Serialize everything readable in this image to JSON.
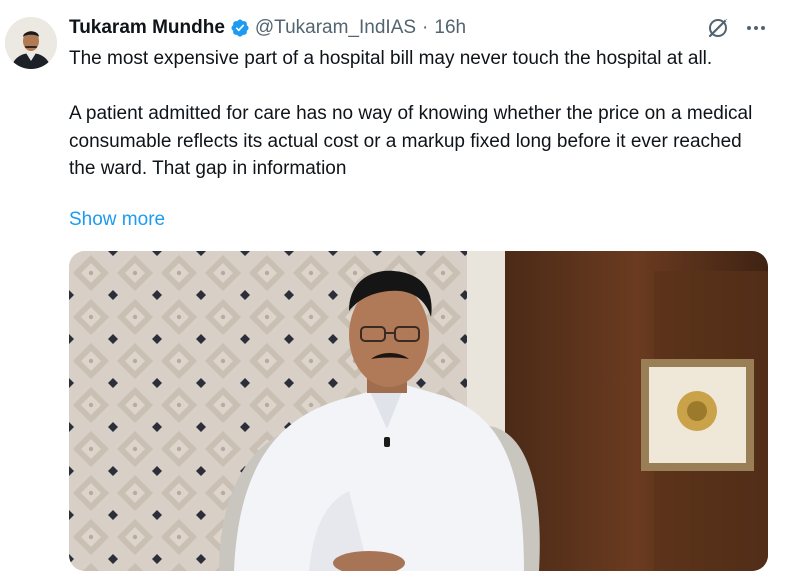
{
  "tweet": {
    "author_name": "Tukaram Mundhe",
    "handle": "@Tukaram_IndIAS",
    "separator": "·",
    "time": "16h",
    "paragraph_1": "The most expensive part of a hospital bill may never touch the hospital at all.",
    "paragraph_2": "A patient admitted for care has no way of knowing whether the price on a medical consumable reflects its actual cost or a markup fixed long before it ever reached the ward. That gap in information",
    "show_more_label": "Show more"
  },
  "icons": {
    "verified": "verified-badge-icon",
    "grok": "grok-icon",
    "more": "more-options-icon"
  },
  "colors": {
    "text": "#0f1419",
    "secondary": "#536471",
    "link": "#1d9bf0",
    "verified": "#1d9bf0"
  }
}
